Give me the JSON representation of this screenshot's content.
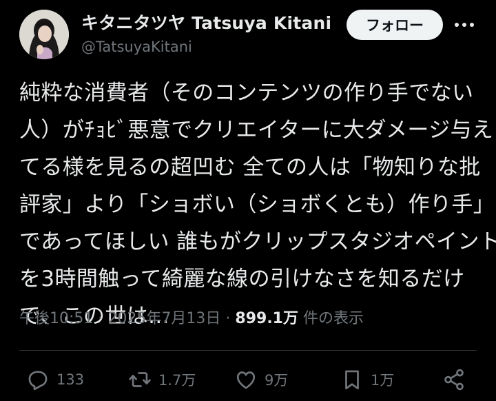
{
  "author": {
    "display_name": "キタニタツヤ Tatsuya Kitani",
    "handle": "@TatsuyaKitani"
  },
  "header": {
    "follow_label": "フォロー"
  },
  "tweet": {
    "lines": [
      "純粋な消費者（そのコンテンツの作り手でない",
      "人）がﾁｮﾋﾞ悪意でクリエイターに大ダメージ与え",
      "てる様を見るの超凹む 全ての人は「物知りな批",
      "評家」より「ショボい（ショボくとも）作り手」",
      "であってほしい 誰もがクリップスタジオペイント",
      "を3時間触って綺麗な線の引けなさを知るだけ",
      "で、この世は..."
    ]
  },
  "meta": {
    "time": "午後10:51",
    "separator": "·",
    "date": "2025年7月13日",
    "views_count": "899.1万",
    "views_label": "件の表示"
  },
  "actions": {
    "replies": "133",
    "reposts": "1.7万",
    "likes": "9万",
    "bookmarks": "1万"
  },
  "colors": {
    "background": "#000000",
    "text_primary": "#e7e9ea",
    "text_secondary": "#71767b",
    "follow_bg": "#eff3f4",
    "divider": "#2f3336"
  }
}
